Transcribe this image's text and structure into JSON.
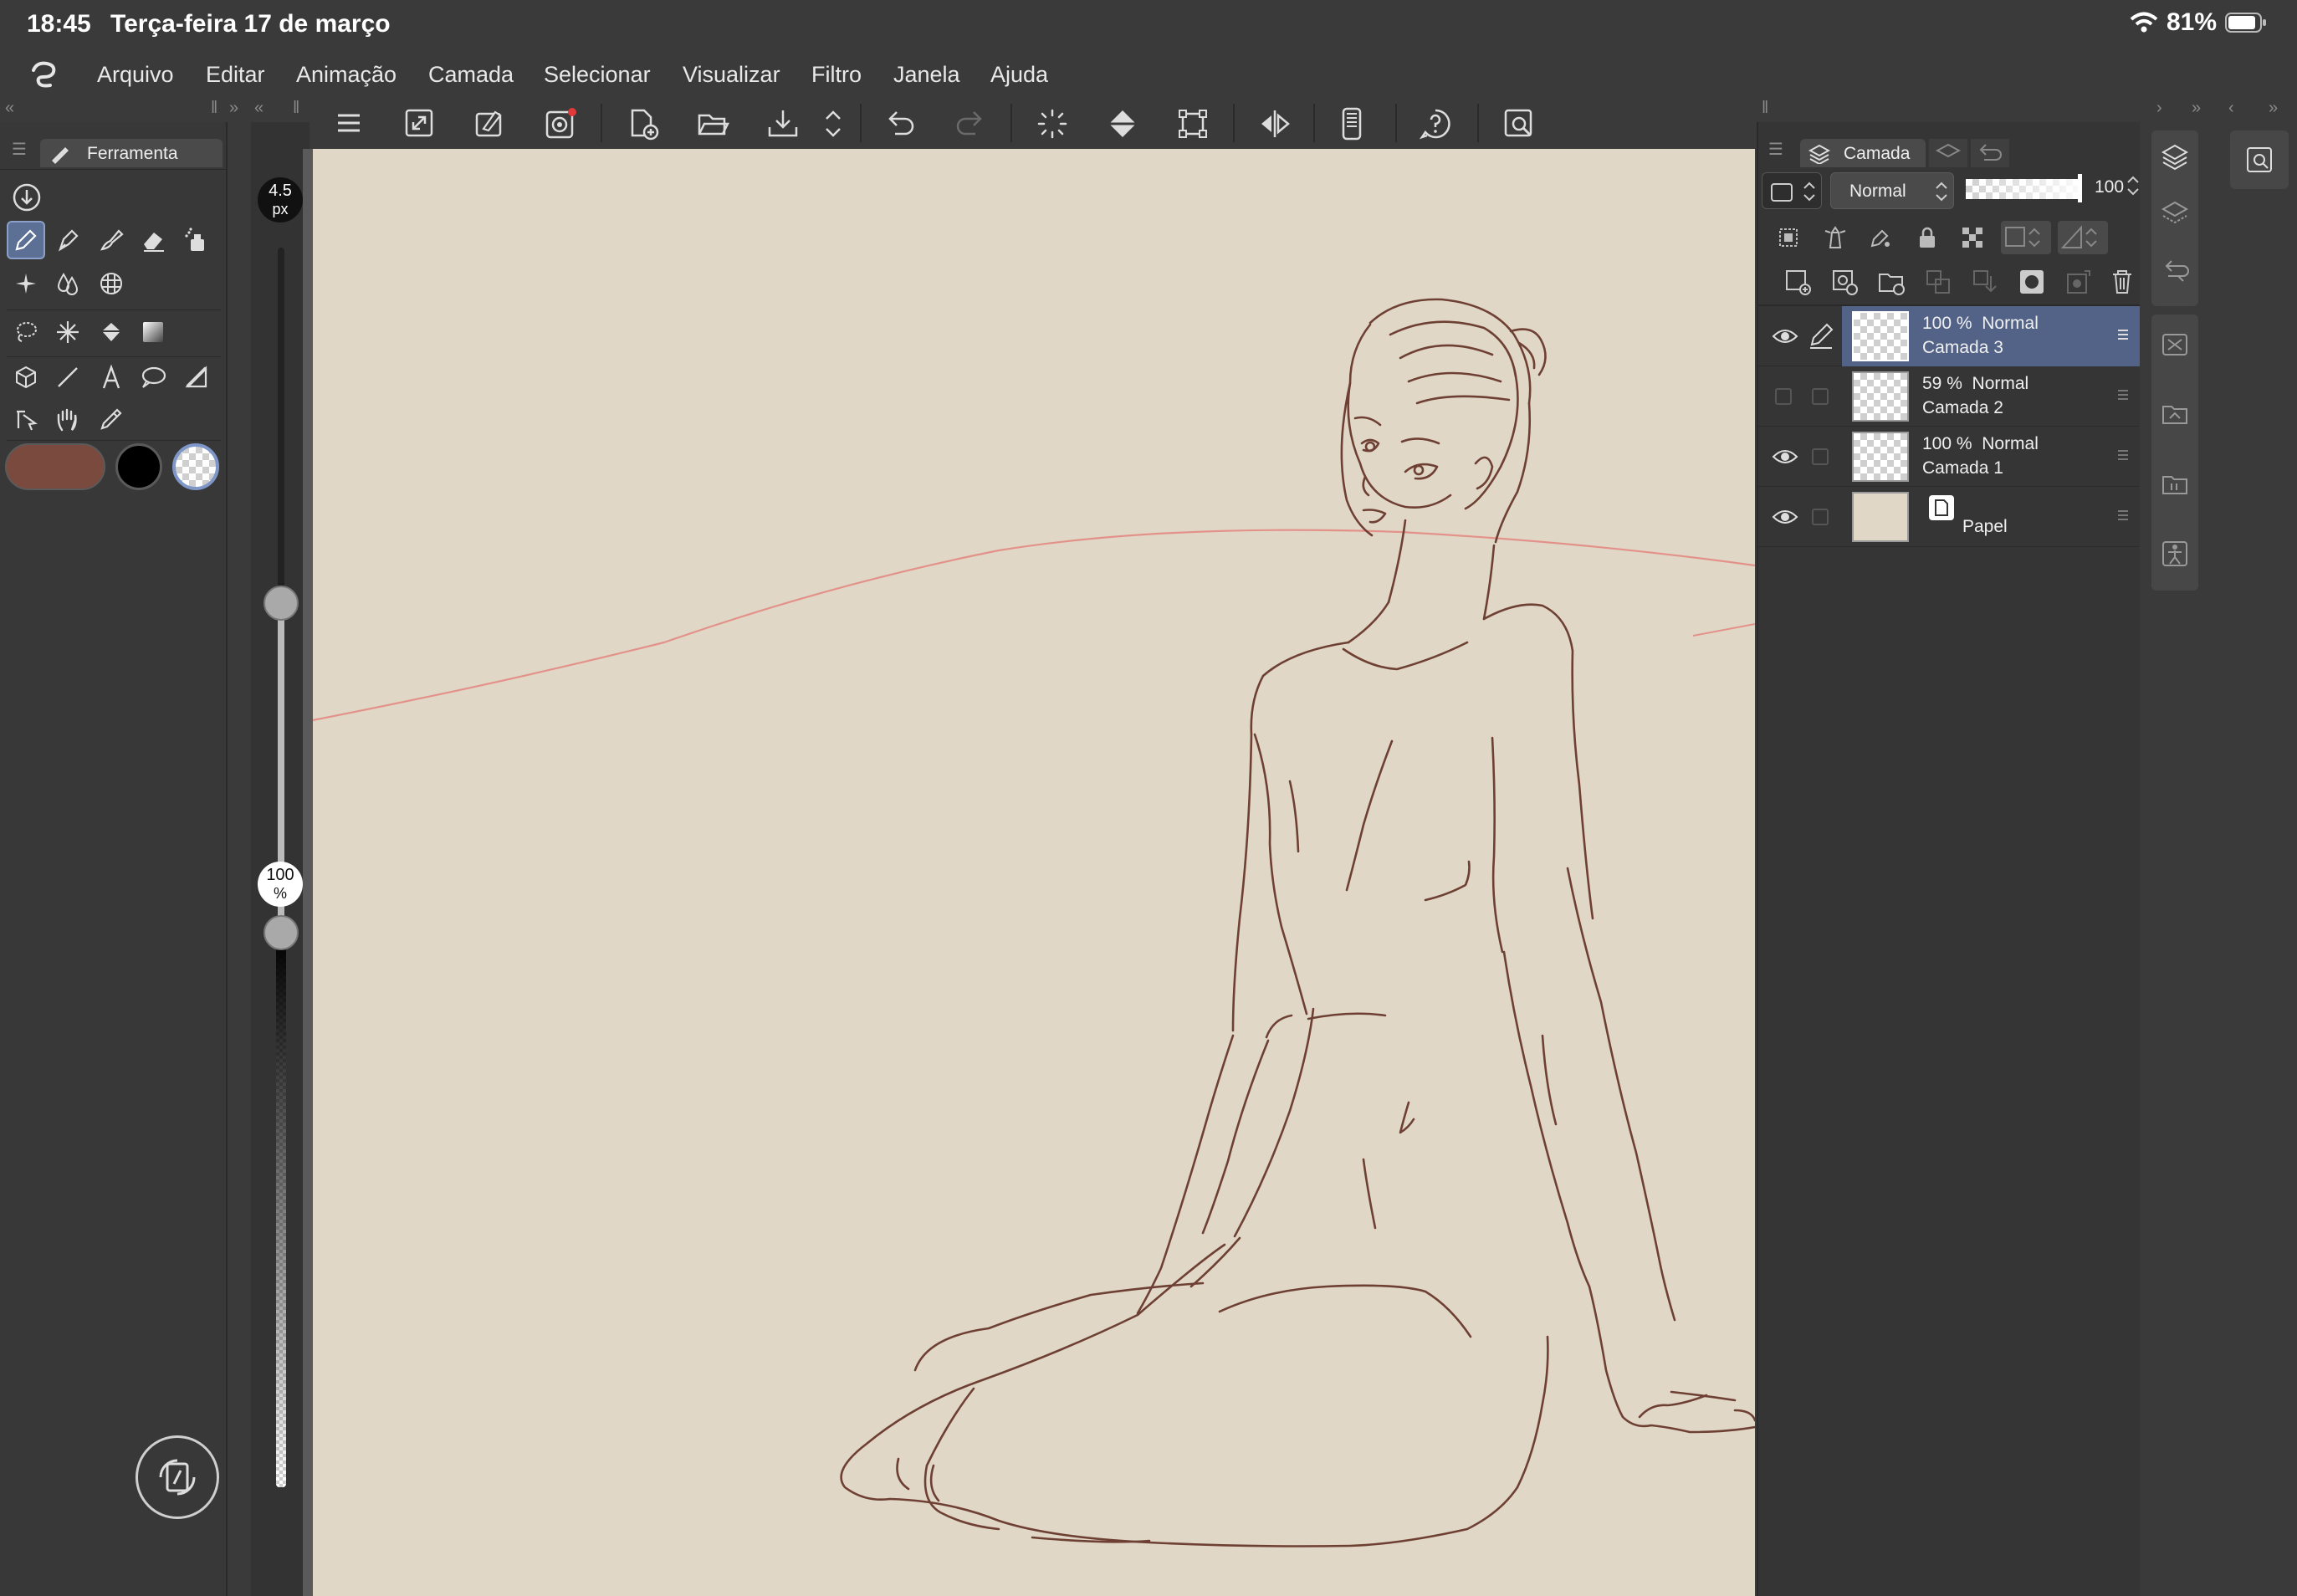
{
  "status": {
    "time": "18:45",
    "date": "Terça-feira 17 de março",
    "battery": "81%"
  },
  "menu": {
    "items": [
      "Arquivo",
      "Editar",
      "Animação",
      "Camada",
      "Selecionar",
      "Visualizar",
      "Filtro",
      "Janela",
      "Ajuda"
    ]
  },
  "tool_panel": {
    "tab_label": "Ferramenta",
    "color_main": "#7a4a3e",
    "color_sub": "#000000"
  },
  "brush": {
    "size_value": "4.5",
    "size_unit": "px",
    "opacity_value": "100",
    "opacity_unit": "%"
  },
  "layer_panel": {
    "tab_label": "Camada",
    "blend_mode": "Normal",
    "opacity": "100",
    "layers": [
      {
        "opacity": "100 %",
        "mode": "Normal",
        "name": "Camada 3",
        "visible": true,
        "selected": true
      },
      {
        "opacity": "59 %",
        "mode": "Normal",
        "name": "Camada 2",
        "visible": false,
        "selected": false
      },
      {
        "opacity": "100 %",
        "mode": "Normal",
        "name": "Camada 1",
        "visible": true,
        "selected": false
      },
      {
        "opacity": "",
        "mode": "",
        "name": "Papel",
        "visible": true,
        "selected": false
      }
    ]
  },
  "colors": {
    "canvas": "#e1d7c6",
    "sketch": "#6e4034",
    "guide": "#e3928a",
    "accent": "#536387"
  }
}
